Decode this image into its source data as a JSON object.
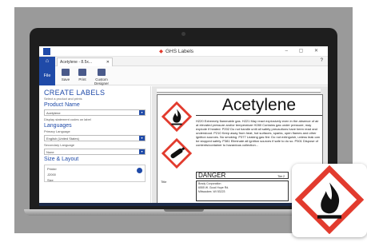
{
  "app": {
    "title": "GHS Labels",
    "doc_tab": "Acetylene - 8.5x...",
    "help": "?",
    "window_controls": "– ▢ ✕",
    "home_icon": "home-icon"
  },
  "ribbon": {
    "file_label": "File",
    "buttons": [
      "Save",
      "Print",
      "Custom Designer"
    ]
  },
  "left_panel": {
    "title": "CREATE LABELS",
    "subtitle": "Select a product and prints",
    "product_header": "Product Name",
    "product_value": "Acetylene",
    "statement_note": "Display statement codes on label",
    "languages_header": "Languages",
    "primary_label": "Primary Language",
    "primary_value": "English (United States)",
    "secondary_label": "Secondary Language",
    "secondary_value": "None",
    "size_header": "Size & Layout",
    "printer_label": "Printer",
    "printer_value": "J2000",
    "size_label": "Size"
  },
  "label": {
    "product_name": "Acetylene",
    "hazard_text": "H220 Extremely flammable gas. H221 May react explosively even in the absence of air at elevated pressure and/or temperature H280 Contains gas under pressure; may explode if heated. P202 Do not handle until all safety precautions have been read and understood. P210 Keep away from heat, hot surfaces, sparks, open flames and other ignition sources. No smoking. P377 Leaking gas fire: Do not extinguish, unless leak can be stopped safely. P381 Eliminate all ignition sources if safe to do so. P501 Dispose of contents/container to hazardous collection...",
    "signal_word": "DANGER",
    "tier": "Tier 2",
    "supplier_lines": [
      "Brady Corporation",
      "6555 W. Good Hope Rd.",
      "Milwaukee, WI 53223"
    ],
    "title_field": "Title"
  },
  "colors": {
    "brand_blue": "#1f4aa8",
    "ghs_red": "#e23b2e"
  },
  "icons": [
    "flame-pictogram",
    "gas-cylinder-pictogram",
    "gear-icon",
    "save-icon",
    "print-icon",
    "designer-icon"
  ]
}
